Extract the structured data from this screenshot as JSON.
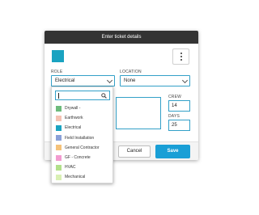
{
  "dialog": {
    "title": "Enter ticket details",
    "color_swatch": "#1aa3c1",
    "role_label": "ROLE",
    "role_value": "Electrical",
    "location_label": "LOCATION",
    "location_value": "None",
    "crew_label": "CREW",
    "crew_value": "14",
    "days_label": "DAYS",
    "days_value": "25",
    "cancel_label": "Cancel",
    "save_label": "Save",
    "accent": "#1a9fd6"
  },
  "dropdown": {
    "search_value": "",
    "items": [
      {
        "label": "Drywall -",
        "color": "#6dbb7c"
      },
      {
        "label": "Earthwork",
        "color": "#f5c2b3"
      },
      {
        "label": "Electrical",
        "color": "#1aa3c1"
      },
      {
        "label": "Field Installation",
        "color": "#8aa0d8"
      },
      {
        "label": "General Contractor",
        "color": "#f5c27a"
      },
      {
        "label": "GF - Concrete",
        "color": "#f29bd0"
      },
      {
        "label": "HVAC",
        "color": "#b2e08a"
      },
      {
        "label": "Mechanical",
        "color": "#d9f0b4"
      }
    ]
  }
}
